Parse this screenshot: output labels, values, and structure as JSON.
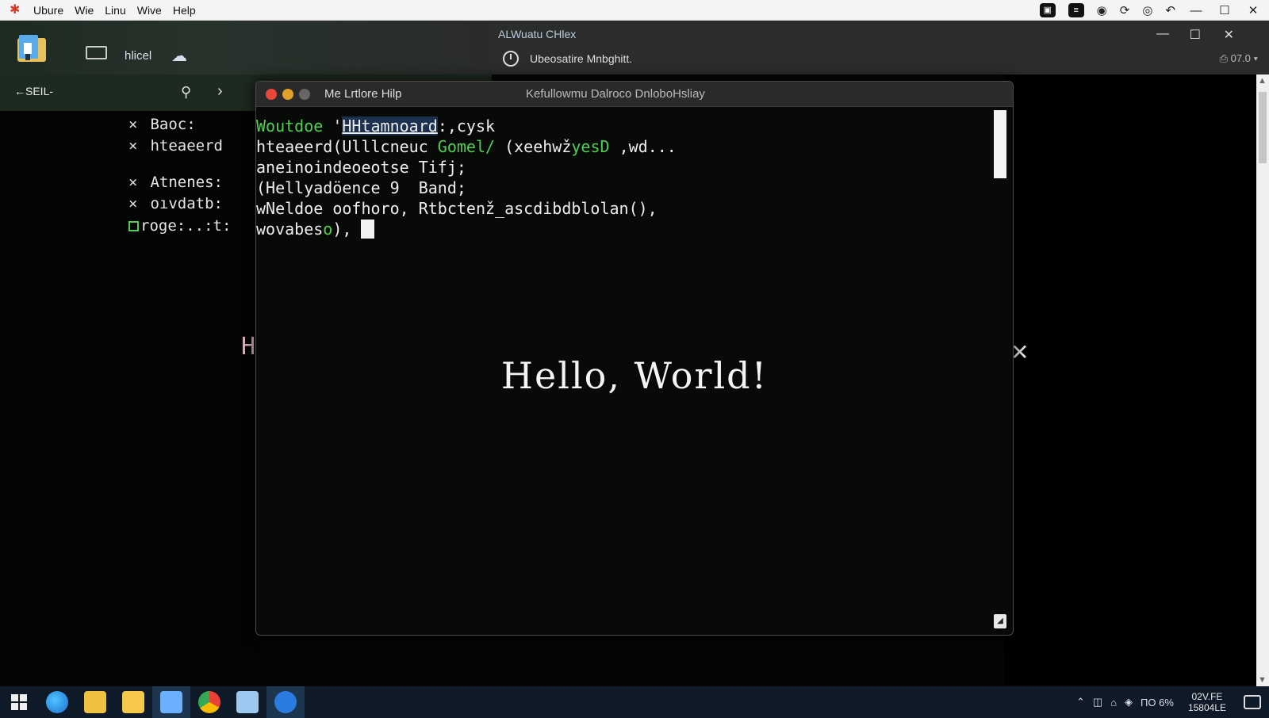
{
  "menubar": {
    "items": [
      "Ubure",
      "Wie",
      "Linu",
      "Wive",
      "Help"
    ]
  },
  "left_toolbar": {
    "label": "hlicel"
  },
  "right_header": {
    "title": "ALWuatu CHlex",
    "status": "Ubeosatire Mnbghitt.",
    "zoom": "07.0"
  },
  "nav": {
    "back_label": "SEIL-"
  },
  "left_list": {
    "items": [
      {
        "marker": "×",
        "text": "Baoc:"
      },
      {
        "marker": "×",
        "text": "hteaeerd"
      },
      {
        "marker": "×",
        "text": "Atnenes:"
      },
      {
        "marker": "×",
        "text": "oıvdatb:"
      },
      {
        "marker": "box",
        "text": "roge:..:t:"
      }
    ],
    "ghost_letter": "H"
  },
  "terminal": {
    "menu": "Me Lrtlore Hilp",
    "tab_title": "Kefullowmu Dalroco  DnloboHsliay",
    "lines": [
      {
        "segments": [
          {
            "t": "Woutdoe",
            "c": "g"
          },
          {
            "t": " '",
            "c": ""
          },
          {
            "t": "HHtamnoard",
            "c": "hl"
          },
          {
            "t": ":,cysk",
            "c": ""
          }
        ]
      },
      {
        "segments": [
          {
            "t": "hteaeerd(Ulllcneuc ",
            "c": ""
          },
          {
            "t": "Gomel/",
            "c": "g"
          },
          {
            "t": " (xeehwž",
            "c": ""
          },
          {
            "t": "yesD",
            "c": "g"
          },
          {
            "t": " ,wd...",
            "c": ""
          }
        ]
      },
      {
        "segments": [
          {
            "t": "aneinoindeoeotse Tifj;",
            "c": ""
          }
        ]
      },
      {
        "segments": [
          {
            "t": "(Hellyadöence 9  Band;",
            "c": ""
          }
        ]
      },
      {
        "segments": [
          {
            "t": "wNeldoe oofhoro, Rtbctenž_ascdibdblolan(),",
            "c": ""
          }
        ]
      },
      {
        "segments": [
          {
            "t": "wovabes",
            "c": ""
          },
          {
            "t": "o",
            "c": "g"
          },
          {
            "t": "), ",
            "c": ""
          }
        ]
      }
    ],
    "hello": "Hello, World!"
  },
  "taskbar": {
    "tray_text": "ΠΟ 6%",
    "clock_time": "02V.FE",
    "clock_date": "15804LE"
  }
}
